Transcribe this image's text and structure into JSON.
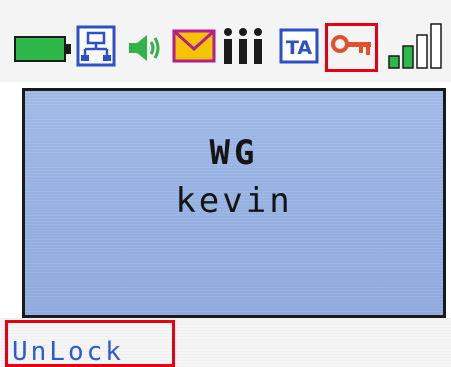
{
  "display": {
    "line1": "WG",
    "line2": "kevin"
  },
  "softkeys": {
    "left": "UnLock"
  },
  "status_icons": [
    "battery-icon",
    "network-icon",
    "speaker-icon",
    "message-icon",
    "ring-tone-icon",
    "ta-icon",
    "key-icon",
    "signal-strength-icon"
  ],
  "labels": {
    "ta": "TA"
  },
  "colors": {
    "highlight": "#e60012",
    "softkey_text": "#2c5bd6",
    "display_bg": "#9fb9e6",
    "battery": "#2db84a",
    "message": "#f0c400",
    "key": "#e0522b"
  }
}
